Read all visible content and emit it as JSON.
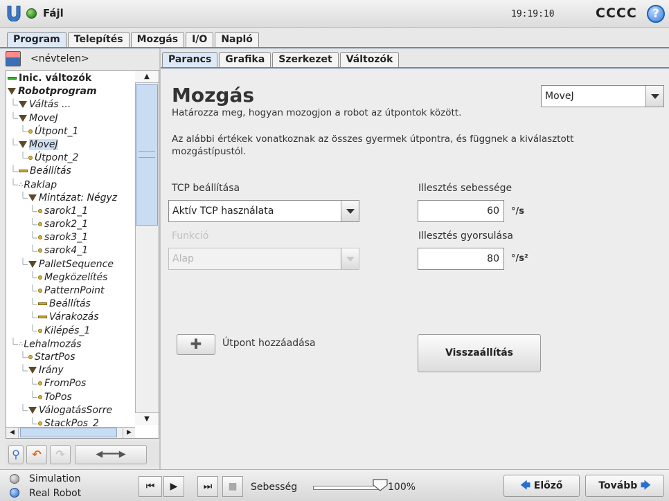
{
  "header": {
    "file_label": "Fájl",
    "clock": "19:19:10",
    "robot_name": "CCCC",
    "help": "?"
  },
  "main_tabs": [
    {
      "label": "Program",
      "active": true
    },
    {
      "label": "Telepítés",
      "active": false
    },
    {
      "label": "Mozgás",
      "active": false
    },
    {
      "label": "I/O",
      "active": false
    },
    {
      "label": "Napló",
      "active": false
    }
  ],
  "program": {
    "file_name": "<névtelen>",
    "tree": [
      {
        "label": "Inic. változók",
        "icon": "bar-green",
        "indent": 0,
        "bold": true,
        "italic": false
      },
      {
        "label": "Robotprogram",
        "icon": "triangle",
        "indent": 0,
        "bold": true,
        "italic": true
      },
      {
        "label": "Váltás ...",
        "icon": "triangle",
        "indent": 1
      },
      {
        "label": "MoveJ",
        "icon": "triangle",
        "indent": 1
      },
      {
        "label": "Útpont_1",
        "icon": "dot",
        "indent": 2
      },
      {
        "label": "MoveJ",
        "icon": "triangle",
        "indent": 1,
        "selected": true
      },
      {
        "label": "Útpont_2",
        "icon": "dot",
        "indent": 2
      },
      {
        "label": "Beállítás",
        "icon": "bar",
        "indent": 1
      },
      {
        "label": "Raklap",
        "icon": "pallet",
        "indent": 1
      },
      {
        "label": "Mintázat: Négyz",
        "icon": "triangle",
        "indent": 2
      },
      {
        "label": "sarok1_1",
        "icon": "dot",
        "indent": 3
      },
      {
        "label": "sarok2_1",
        "icon": "dot",
        "indent": 3
      },
      {
        "label": "sarok3_1",
        "icon": "dot",
        "indent": 3
      },
      {
        "label": "sarok4_1",
        "icon": "dot",
        "indent": 3
      },
      {
        "label": "PalletSequence",
        "icon": "triangle",
        "indent": 2
      },
      {
        "label": "Megközelítés",
        "icon": "dot",
        "indent": 3
      },
      {
        "label": "PatternPoint",
        "icon": "dot",
        "indent": 3
      },
      {
        "label": "Beállítás",
        "icon": "bar",
        "indent": 3
      },
      {
        "label": "Várakozás",
        "icon": "bar",
        "indent": 3
      },
      {
        "label": "Kilépés_1",
        "icon": "dot",
        "indent": 3
      },
      {
        "label": "Lehalmozás",
        "icon": "pallet",
        "indent": 1
      },
      {
        "label": "StartPos",
        "icon": "dot",
        "indent": 2
      },
      {
        "label": "Irány",
        "icon": "triangle",
        "indent": 2
      },
      {
        "label": "FromPos",
        "icon": "dot",
        "indent": 3
      },
      {
        "label": "ToPos",
        "icon": "dot",
        "indent": 3
      },
      {
        "label": "VálogatásSorre",
        "icon": "triangle",
        "indent": 2
      },
      {
        "label": "StackPos_2",
        "icon": "dot",
        "indent": 3
      }
    ]
  },
  "sub_tabs": [
    {
      "label": "Parancs",
      "active": true
    },
    {
      "label": "Grafika",
      "active": false
    },
    {
      "label": "Szerkezet",
      "active": false
    },
    {
      "label": "Változók",
      "active": false
    }
  ],
  "command": {
    "title": "Mozgás",
    "move_type": "MoveJ",
    "description1": "Határozza meg, hogyan mozogjon a robot az útpontok között.",
    "description2": "Az alábbi értékek vonatkoznak az összes gyermek útpontra, és függnek a kiválasztott mozgástípustól.",
    "tcp_label": "TCP beállítása",
    "tcp_value": "Aktív TCP használata",
    "feature_label": "Funkció",
    "feature_value": "Alap",
    "speed_label": "Illesztés sebessége",
    "speed_value": "60",
    "speed_unit": "°/s",
    "accel_label": "Illesztés gyorsulása",
    "accel_value": "80",
    "accel_unit": "°/s²",
    "add_waypoint_label": "Útpont hozzáadása",
    "reset_label": "Visszaállítás"
  },
  "bottom": {
    "simulation_label": "Simulation",
    "real_robot_label": "Real Robot",
    "speed_label": "Sebesség",
    "speed_percent": "100%",
    "speed_fraction": 1.0,
    "prev_label": "Előző",
    "next_label": "Tovább"
  }
}
